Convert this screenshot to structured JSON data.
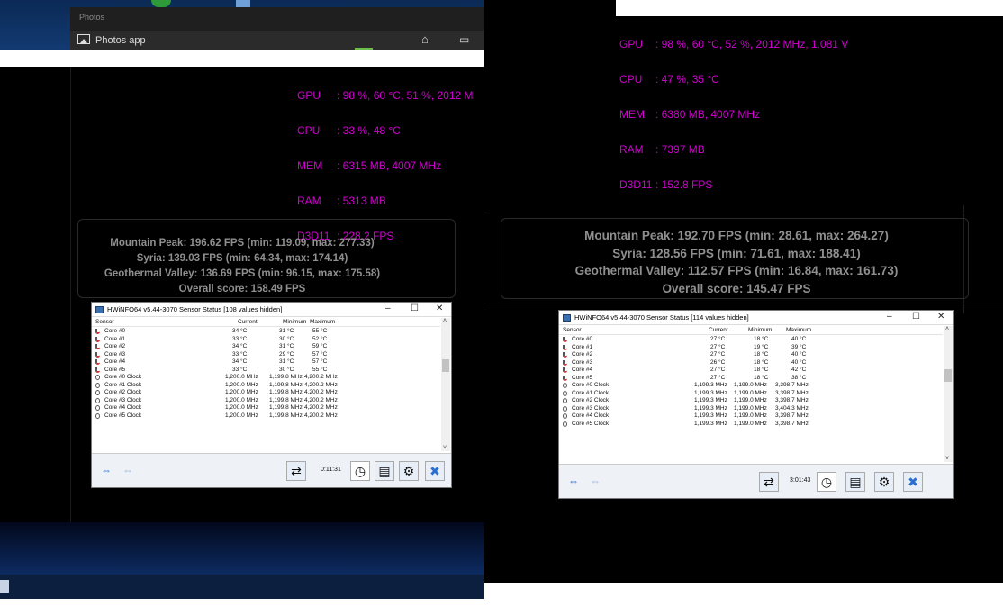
{
  "left_screen": {
    "photos_window": {
      "title": "Photos",
      "app_label": "Photos app"
    },
    "osd": {
      "gpu_label": "GPU",
      "gpu_value": ": 98 %, 60 °C, 51 %, 2012 M",
      "cpu_label": "CPU",
      "cpu_value": ": 33 %, 48 °C",
      "mem_label": "MEM",
      "mem_value": ": 6315 MB, 4007 MHz",
      "ram_label": "RAM",
      "ram_value": ": 5313 MB",
      "d3d_label": "D3D11",
      "d3d_value": ": 228.2 FPS"
    },
    "benchmark": {
      "line1": "Mountain Peak: 196.62 FPS (min: 119.09, max: 277.33)",
      "line2": "Syria: 139.03 FPS (min: 64.34, max: 174.14)",
      "line3": "Geothermal Valley: 136.69 FPS (min: 96.15, max: 175.58)",
      "line4": "Overall score: 158.49 FPS"
    },
    "hwinfo": {
      "title": "HWiNFO64 v5.44-3070 Sensor Status [108 values hidden]",
      "col_sensor": "Sensor",
      "col_current": "Current",
      "col_minimum": "Minimum",
      "col_maximum": "Maximum",
      "rows": [
        {
          "name": "Core #0",
          "cur": "34 °C",
          "min": "31 °C",
          "max": "55 °C"
        },
        {
          "name": "Core #1",
          "cur": "33 °C",
          "min": "30 °C",
          "max": "52 °C"
        },
        {
          "name": "Core #2",
          "cur": "34 °C",
          "min": "31 °C",
          "max": "59 °C"
        },
        {
          "name": "Core #3",
          "cur": "33 °C",
          "min": "29 °C",
          "max": "57 °C"
        },
        {
          "name": "Core #4",
          "cur": "34 °C",
          "min": "31 °C",
          "max": "57 °C"
        },
        {
          "name": "Core #5",
          "cur": "33 °C",
          "min": "30 °C",
          "max": "55 °C"
        },
        {
          "name": "Core #0 Clock",
          "cur": "1,200.0 MHz",
          "min": "1,199.8 MHz",
          "max": "4,200.2 MHz"
        },
        {
          "name": "Core #1 Clock",
          "cur": "1,200.0 MHz",
          "min": "1,199.8 MHz",
          "max": "4,200.2 MHz"
        },
        {
          "name": "Core #2 Clock",
          "cur": "1,200.0 MHz",
          "min": "1,199.8 MHz",
          "max": "4,200.2 MHz"
        },
        {
          "name": "Core #3 Clock",
          "cur": "1,200.0 MHz",
          "min": "1,199.8 MHz",
          "max": "4,200.2 MHz"
        },
        {
          "name": "Core #4 Clock",
          "cur": "1,200.0 MHz",
          "min": "1,199.8 MHz",
          "max": "4,200.2 MHz"
        },
        {
          "name": "Core #5 Clock",
          "cur": "1,200.0 MHz",
          "min": "1,199.8 MHz",
          "max": "4,200.2 MHz"
        }
      ],
      "timer": "0:11:31"
    }
  },
  "right_screen": {
    "osd": {
      "gpu_label": "GPU",
      "gpu_value": ": 98 %, 60 °C, 52 %, 2012 MHz, 1.081 V",
      "cpu_label": "CPU",
      "cpu_value": ": 47 %, 35 °C",
      "mem_label": "MEM",
      "mem_value": ": 6380 MB, 4007 MHz",
      "ram_label": "RAM",
      "ram_value": ": 7397 MB",
      "d3d_label": "D3D11",
      "d3d_value": ": 152.8 FPS"
    },
    "benchmark": {
      "line1": "Mountain Peak: 192.70 FPS (min: 28.61, max: 264.27)",
      "line2": "Syria: 128.56 FPS (min: 71.61, max: 188.41)",
      "line3": "Geothermal Valley: 112.57 FPS (min: 16.84, max: 161.73)",
      "line4": "Overall score: 145.47 FPS"
    },
    "hwinfo": {
      "title": "HWiNFO64 v5.44-3070 Sensor Status [114 values hidden]",
      "col_sensor": "Sensor",
      "col_current": "Current",
      "col_minimum": "Minimum",
      "col_maximum": "Maximum",
      "rows": [
        {
          "name": "Core #0",
          "cur": "27 °C",
          "min": "18 °C",
          "max": "40 °C"
        },
        {
          "name": "Core #1",
          "cur": "27 °C",
          "min": "19 °C",
          "max": "39 °C"
        },
        {
          "name": "Core #2",
          "cur": "27 °C",
          "min": "18 °C",
          "max": "40 °C"
        },
        {
          "name": "Core #3",
          "cur": "26 °C",
          "min": "18 °C",
          "max": "40 °C"
        },
        {
          "name": "Core #4",
          "cur": "27 °C",
          "min": "18 °C",
          "max": "42 °C"
        },
        {
          "name": "Core #5",
          "cur": "27 °C",
          "min": "18 °C",
          "max": "38 °C"
        },
        {
          "name": "Core #0 Clock",
          "cur": "1,199.3 MHz",
          "min": "1,199.0 MHz",
          "max": "3,398.7 MHz"
        },
        {
          "name": "Core #1 Clock",
          "cur": "1,199.3 MHz",
          "min": "1,199.0 MHz",
          "max": "3,398.7 MHz"
        },
        {
          "name": "Core #2 Clock",
          "cur": "1,199.3 MHz",
          "min": "1,199.0 MHz",
          "max": "3,398.7 MHz"
        },
        {
          "name": "Core #3 Clock",
          "cur": "1,199.3 MHz",
          "min": "1,199.0 MHz",
          "max": "3,404.3 MHz"
        },
        {
          "name": "Core #4 Clock",
          "cur": "1,199.3 MHz",
          "min": "1,199.0 MHz",
          "max": "3,398.7 MHz"
        },
        {
          "name": "Core #5 Clock",
          "cur": "1,199.3 MHz",
          "min": "1,199.0 MHz",
          "max": "3,398.7 MHz"
        }
      ],
      "timer": "3:01:43"
    }
  },
  "colors": {
    "osd": "#d200d2",
    "bench_text": "#8f8f8f",
    "background": "#000000"
  }
}
